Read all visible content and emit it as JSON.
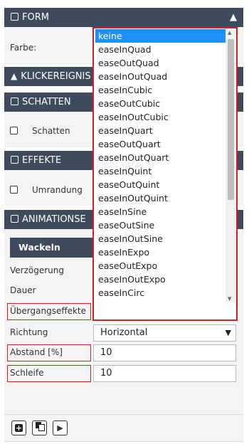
{
  "form": {
    "title": "FORM",
    "farbe_label": "Farbe:"
  },
  "click": {
    "title": "KLICKEREIGNIS"
  },
  "shadow": {
    "title": "SCHATTEN",
    "checkbox_label": "Schatten"
  },
  "effects": {
    "title": "EFFEKTE",
    "checkbox_label": "Umrandung"
  },
  "animation": {
    "title": "ANIMATIONSE",
    "tab": "Wackeln",
    "delay_label": "Verzögerung",
    "duration_label": "Dauer",
    "transition_label": "Übergangseffekte",
    "transition_value": "keine",
    "direction_label": "Richtung",
    "direction_value": "Horizontal",
    "distance_label": "Abstand [%]",
    "distance_value": "10",
    "loop_label": "Schleife",
    "loop_value": "10"
  },
  "dropdown": {
    "options": [
      "keine",
      "easeInQuad",
      "easeOutQuad",
      "easeInOutQuad",
      "easeInCubic",
      "easeOutCubic",
      "easeInOutCubic",
      "easeInQuart",
      "easeOutQuart",
      "easeInOutQuart",
      "easeInQuint",
      "easeOutQuint",
      "easeInOutQuint",
      "easeInSine",
      "easeOutSine",
      "easeInOutSine",
      "easeInExpo",
      "easeOutExpo",
      "easeInOutExpo",
      "easeInCirc"
    ],
    "selected": "keine"
  },
  "icons": {
    "collapse": "chevron-up-icon",
    "pointer": "cursor-icon",
    "add": "plus-icon",
    "copy": "copy-icon",
    "play": "play-icon",
    "dropdown_arrow": "triangle-down-icon"
  }
}
